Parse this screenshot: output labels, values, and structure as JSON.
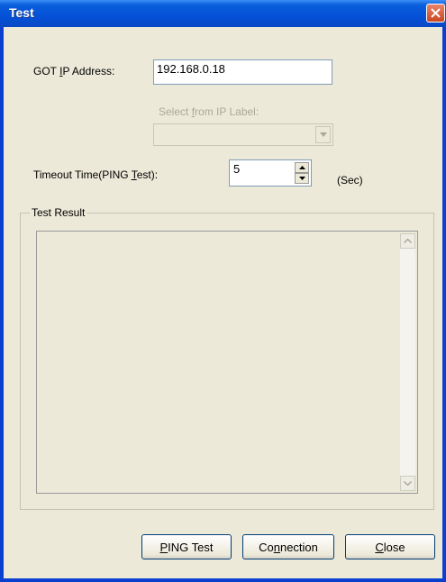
{
  "window": {
    "title": "Test",
    "close_icon": "close-icon"
  },
  "ip": {
    "label_pre": "GOT ",
    "label_key": "I",
    "label_post": "P Address:",
    "value": "192.168.0.18"
  },
  "select_label": {
    "pre": "Select ",
    "key": "f",
    "post": "rom IP Label:"
  },
  "timeout": {
    "label_pre": "Timeout Time(PING ",
    "label_key": "T",
    "label_post": "est):",
    "value": "5",
    "unit": "(Sec)"
  },
  "result": {
    "group_label": "Test Result"
  },
  "buttons": {
    "ping": {
      "key": "P",
      "rest": "ING Test"
    },
    "connection": {
      "pre": "Co",
      "key": "n",
      "post": "nection"
    },
    "close": {
      "key": "C",
      "rest": "lose"
    }
  },
  "colors": {
    "titlebar": "#0551d8",
    "dialog_bg": "#ece9d8",
    "close_button": "#c9461f"
  }
}
